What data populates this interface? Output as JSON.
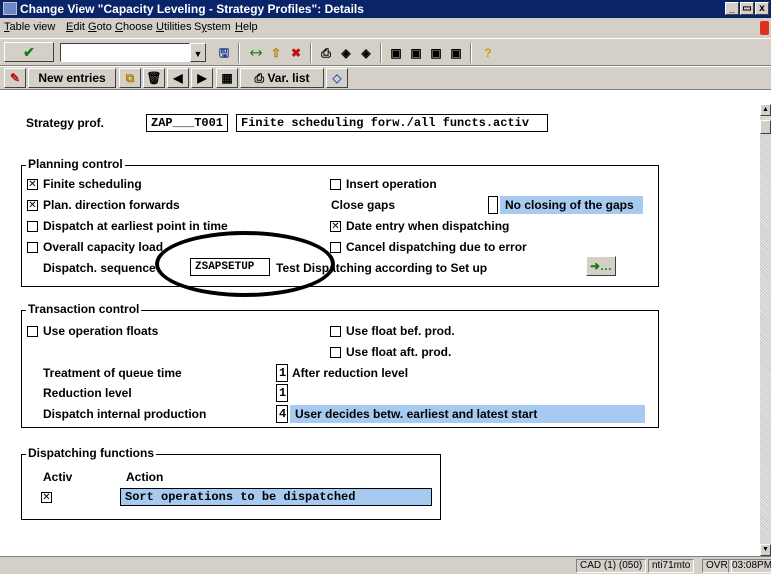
{
  "window": {
    "title": "Change View \"Capacity Leveling - Strategy Profiles\": Details"
  },
  "menu": [
    {
      "pre": "",
      "ul": "T",
      "post": "able view"
    },
    {
      "pre": "",
      "ul": "E",
      "post": "dit"
    },
    {
      "pre": "",
      "ul": "G",
      "post": "oto"
    },
    {
      "pre": "",
      "ul": "C",
      "post": "hoose"
    },
    {
      "pre": "",
      "ul": "U",
      "post": "tilities"
    },
    {
      "pre": "S",
      "ul": "y",
      "post": "stem"
    },
    {
      "pre": "",
      "ul": "H",
      "post": "elp"
    }
  ],
  "toolbar2": {
    "new_entries": "New entries",
    "var_list": "Var. list"
  },
  "header": {
    "strategy_label": "Strategy prof.",
    "strategy_value": "ZAP___T001",
    "strategy_desc": "Finite scheduling forw./all functs.activ"
  },
  "planning": {
    "title": "Planning control",
    "finite_scheduling": "Finite scheduling",
    "plan_forwards": "Plan. direction forwards",
    "dispatch_earliest": "Dispatch at earliest point in time",
    "overall_load": "Overall capacity load",
    "dispatch_seq_label": "Dispatch. sequence",
    "dispatch_seq_value": "ZSAPSETUP",
    "dispatch_seq_desc": "Test Dispatching according to Set up",
    "insert_operation": "Insert operation",
    "close_gaps_label": "Close gaps",
    "close_gaps_value": "No closing of the gaps",
    "date_entry": "Date entry when dispatching",
    "cancel_dispatching": "Cancel dispatching due to error"
  },
  "transaction": {
    "title": "Transaction control",
    "use_op_floats": "Use operation floats",
    "float_bef": "Use float bef. prod.",
    "float_aft": "Use float aft. prod.",
    "queue_label": "Treatment of queue time",
    "queue_code": "1",
    "queue_desc": "After reduction level",
    "reduction_label": "Reduction level",
    "reduction_code": "1",
    "dispatch_int_label": "Dispatch internal production",
    "dispatch_int_code": "4",
    "dispatch_int_desc": "User decides betw. earliest and latest start"
  },
  "functions": {
    "title": "Dispatching functions",
    "col_activ": "Activ",
    "col_action": "Action",
    "row_action": "Sort operations to be dispatched"
  },
  "status": {
    "system": "CAD (1) (050)",
    "server": "nti71mto",
    "mode": "OVR",
    "time": "03:08PM"
  },
  "checks": {
    "finite_scheduling": true,
    "plan_forwards": true,
    "dispatch_earliest": false,
    "overall_load": false,
    "insert_operation": false,
    "date_entry": true,
    "cancel_dispatching": false,
    "use_op_floats": false,
    "float_bef": false,
    "float_aft": false,
    "activ_row": true
  },
  "colors": {
    "title_bar": "#0a246a",
    "chrome": "#d4d0c8",
    "field_highlight": "#a6caf0"
  }
}
